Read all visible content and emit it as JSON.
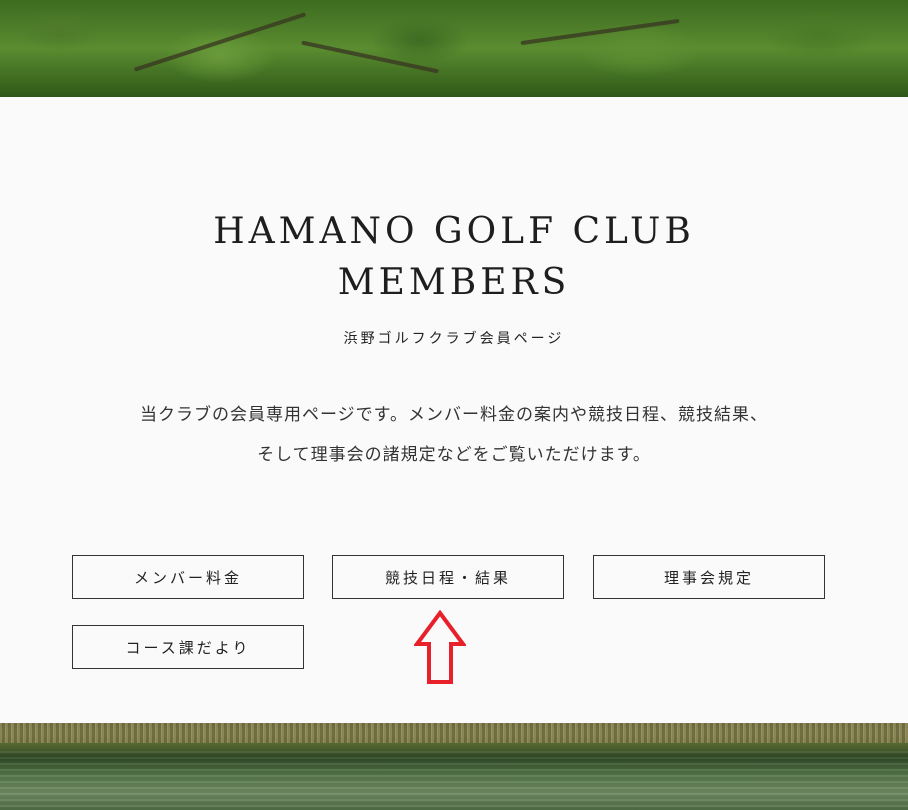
{
  "header": {
    "title_line1": "HAMANO GOLF CLUB",
    "title_line2": "MEMBERS",
    "subtitle": "浜野ゴルフクラブ会員ページ"
  },
  "intro": {
    "line1": "当クラブの会員専用ページです。メンバー料金の案内や競技日程、競技結果、",
    "line2": "そして理事会の諸規定などをご覧いただけます。"
  },
  "nav_buttons": {
    "members_fee": "メンバー料金",
    "competition": "競技日程・結果",
    "board_rules": "理事会規定",
    "course_news": "コース課だより"
  },
  "annotation": {
    "arrow_color": "#e8202a"
  }
}
